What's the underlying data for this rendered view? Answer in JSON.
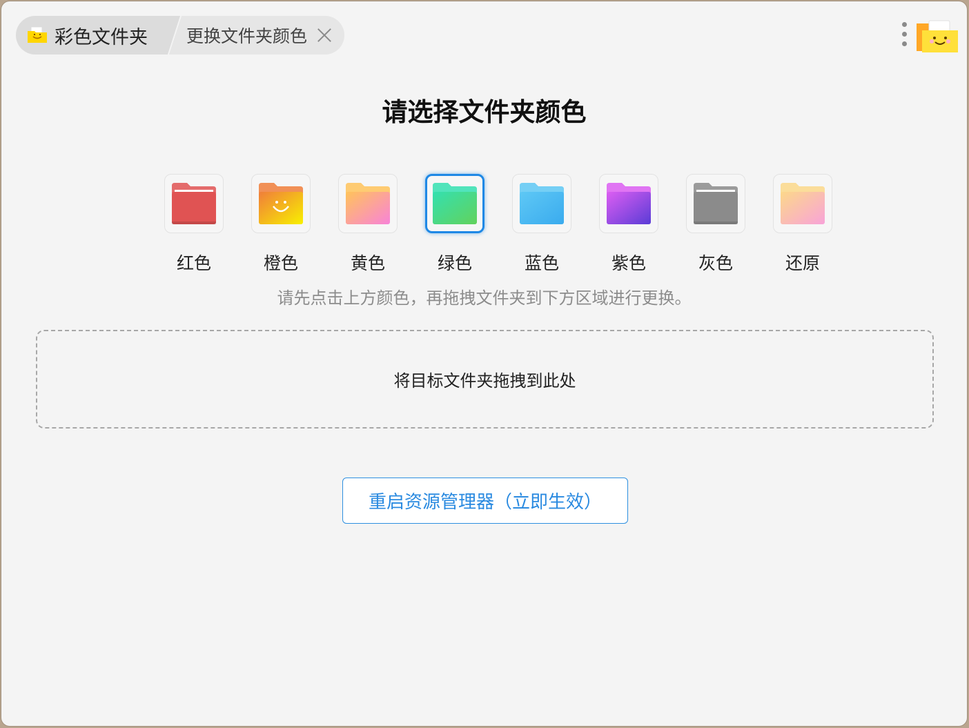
{
  "breadcrumb": {
    "home_label": "彩色文件夹",
    "current_label": "更换文件夹颜色"
  },
  "page": {
    "title": "请选择文件夹颜色",
    "hint": "请先点击上方颜色，再拖拽文件夹到下方区域进行更换。",
    "dropzone_label": "将目标文件夹拖拽到此处",
    "restart_button": "重启资源管理器（立即生效）"
  },
  "colors": [
    {
      "label": "红色",
      "icon": "folder-red-icon",
      "colors": [
        "#e05353",
        "#e05353"
      ]
    },
    {
      "label": "橙色",
      "icon": "folder-orange-smile-icon",
      "colors": [
        "#f07e3a",
        "#f8f000"
      ]
    },
    {
      "label": "黄色",
      "icon": "folder-yellow-icon",
      "colors": [
        "#ffc35a",
        "#f883d8"
      ]
    },
    {
      "label": "绿色",
      "icon": "folder-green-icon",
      "colors": [
        "#34e0b0",
        "#62d25c"
      ],
      "selected": true
    },
    {
      "label": "蓝色",
      "icon": "folder-blue-icon",
      "colors": [
        "#5ec8f5",
        "#3aabee"
      ]
    },
    {
      "label": "紫色",
      "icon": "folder-purple-icon",
      "colors": [
        "#dc5ef2",
        "#5a3cd6"
      ]
    },
    {
      "label": "灰色",
      "icon": "folder-gray-icon",
      "colors": [
        "#8b8b8b",
        "#8b8b8b"
      ]
    },
    {
      "label": "还原",
      "icon": "folder-restore-icon",
      "colors": [
        "#fcd88a",
        "#f8a3d8"
      ]
    }
  ],
  "accent_color": "#1e88e5"
}
